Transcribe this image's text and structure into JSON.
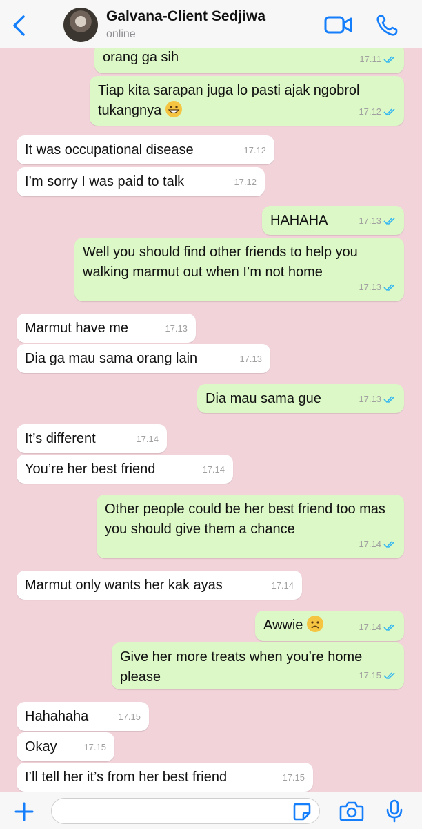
{
  "header": {
    "contact_name": "Galvana-Client Sedjiwa",
    "status": "online"
  },
  "colors": {
    "accent": "#147efb",
    "background": "#f2d3da",
    "outgoing_bubble": "#dcf8c6",
    "incoming_bubble": "#ffffff",
    "read_tick": "#34b7f1"
  },
  "messages": [
    {
      "direction": "out",
      "text": "orang ga sih",
      "time": "17.11",
      "read": true
    },
    {
      "direction": "out",
      "text": "Tiap kita sarapan juga lo pasti ajak ngobrol tukangnya",
      "emoji": "grinning-face",
      "time": "17.12",
      "read": true
    },
    {
      "direction": "in",
      "text": "It was occupational disease",
      "time": "17.12"
    },
    {
      "direction": "in",
      "text": "I’m sorry I was paid to talk",
      "time": "17.12"
    },
    {
      "direction": "out",
      "text": "HAHAHA",
      "time": "17.13",
      "read": true
    },
    {
      "direction": "out",
      "text": "Well you should find other friends to help you walking marmut out when I’m not home",
      "time": "17.13",
      "read": true
    },
    {
      "direction": "in",
      "text": "Marmut have me",
      "time": "17.13"
    },
    {
      "direction": "in",
      "text": "Dia ga mau sama orang lain",
      "time": "17.13"
    },
    {
      "direction": "out",
      "text": "Dia mau sama gue",
      "time": "17.13",
      "read": true
    },
    {
      "direction": "in",
      "text": "It’s different",
      "time": "17.14"
    },
    {
      "direction": "in",
      "text": "You’re her best friend",
      "time": "17.14"
    },
    {
      "direction": "out",
      "text": "Other people could be her best friend too mas you should give them a chance",
      "time": "17.14",
      "read": true
    },
    {
      "direction": "in",
      "text": "Marmut only wants her kak ayas",
      "time": "17.14"
    },
    {
      "direction": "out",
      "text": "Awwie",
      "emoji": "frowning-face",
      "time": "17.14",
      "read": true
    },
    {
      "direction": "out",
      "text": "Give her more treats when you’re home please",
      "time": "17.15",
      "read": true
    },
    {
      "direction": "in",
      "text": "Hahahaha",
      "time": "17.15"
    },
    {
      "direction": "in",
      "text": "Okay",
      "time": "17.15"
    },
    {
      "direction": "in",
      "text": "I’ll tell her it’s from her best friend",
      "time": "17.15"
    }
  ],
  "composer": {
    "value": "",
    "icons": [
      "plus-icon",
      "sticker-icon",
      "camera-icon",
      "microphone-icon"
    ]
  }
}
